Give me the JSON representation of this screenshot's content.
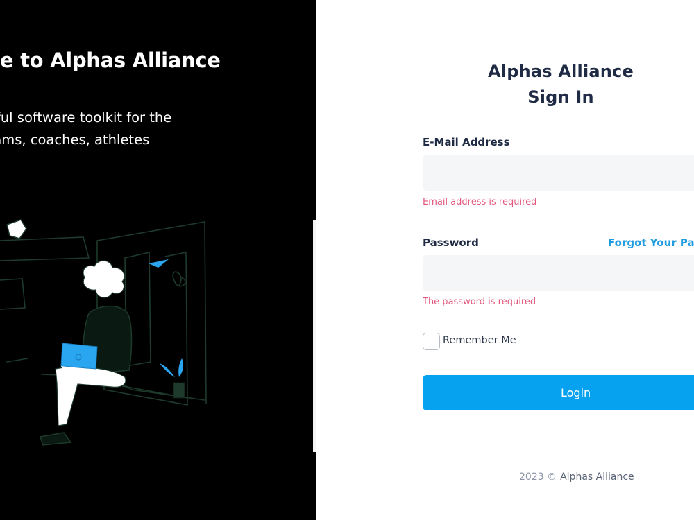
{
  "hero": {
    "title": "me to Alphas Alliance",
    "subtitle_line1": "werful software toolkit for the",
    "subtitle_line2": "ograms, coaches, athletes"
  },
  "signin": {
    "app_name": "Alphas Alliance",
    "title": "Sign In",
    "email": {
      "label": "E-Mail Address",
      "value": "",
      "error": "Email address is required"
    },
    "password": {
      "label": "Password",
      "value": "",
      "forgot_link": "Forgot Your Pass",
      "error": "The password is required"
    },
    "remember_me": {
      "label": "Remember Me",
      "checked": false
    },
    "login_label": "Login"
  },
  "footer": {
    "year": "2023 ©",
    "company": "Alphas Alliance"
  },
  "colors": {
    "accent": "#06a2ef",
    "link": "#1f9be0",
    "error": "#e15a7e",
    "heading": "#1f2a44",
    "input_bg": "#f4f6f8",
    "left_panel_bg": "#000000",
    "illustration_outline": "#1d3a2c"
  }
}
